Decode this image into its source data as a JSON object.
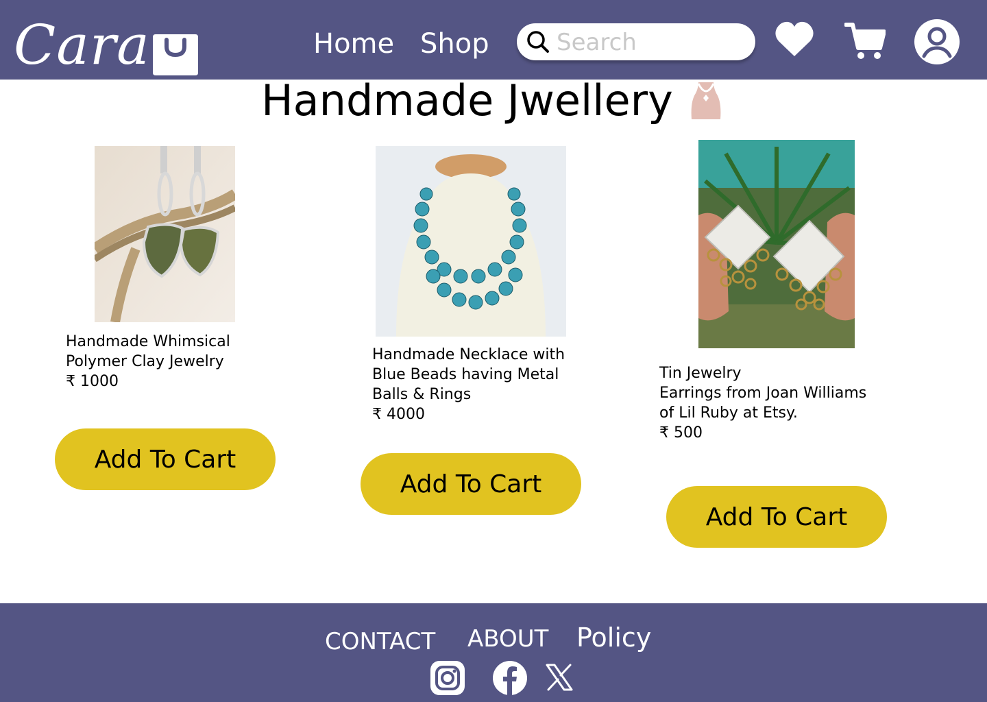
{
  "nav": {
    "brand": "Cara",
    "links": [
      {
        "label": "Home"
      },
      {
        "label": "Shop"
      }
    ],
    "search_placeholder": "Search",
    "icons": [
      "heart-icon",
      "cart-icon",
      "user-icon"
    ]
  },
  "page": {
    "title": "Handmade Jwellery"
  },
  "products": [
    {
      "name": "Handmade Whimsical\nPolymer Clay Jewelry",
      "price": "₹ 1000",
      "button": "Add To Cart"
    },
    {
      "name": "Handmade Necklace with\nBlue Beads having Metal\nBalls & Rings",
      "price": "₹ 4000",
      "button": "Add To Cart"
    },
    {
      "name": "Tin Jewelry\nEarrings from Joan Williams\nof Lil Ruby at Etsy.",
      "price": "₹ 500",
      "button": "Add To Cart"
    }
  ],
  "footer": {
    "links": [
      {
        "label": "CONTACT"
      },
      {
        "label": "ABOUT"
      },
      {
        "label": "Policy"
      }
    ],
    "social": [
      "instagram-icon",
      "facebook-icon",
      "x-icon"
    ]
  },
  "colors": {
    "nav_bg": "#545584",
    "button_bg": "#e1c320",
    "accent_icon": "#e3bdb4"
  }
}
